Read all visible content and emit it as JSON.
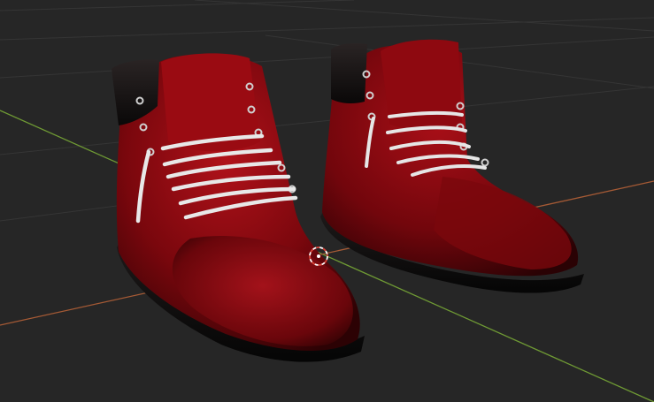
{
  "app": {
    "type": "3d-viewport",
    "mode": "object"
  },
  "scene": {
    "background_color": "#262626",
    "grid_line_color": "#3a3a3a",
    "x_axis_color": "#b0603a",
    "y_axis_color": "#7aa33a",
    "object": {
      "name": "boots",
      "primary_color": "#8e0a10",
      "dark_color": "#3a0306",
      "collar_color": "#141010",
      "sole_color": "#101010",
      "lace_color": "#e6e6e6",
      "eyelet_color": "#c8c8c8"
    },
    "cursor_3d": {
      "icon": "3d-cursor-icon",
      "ring_color_a": "#ffffff",
      "ring_color_b": "#d9443a"
    }
  }
}
